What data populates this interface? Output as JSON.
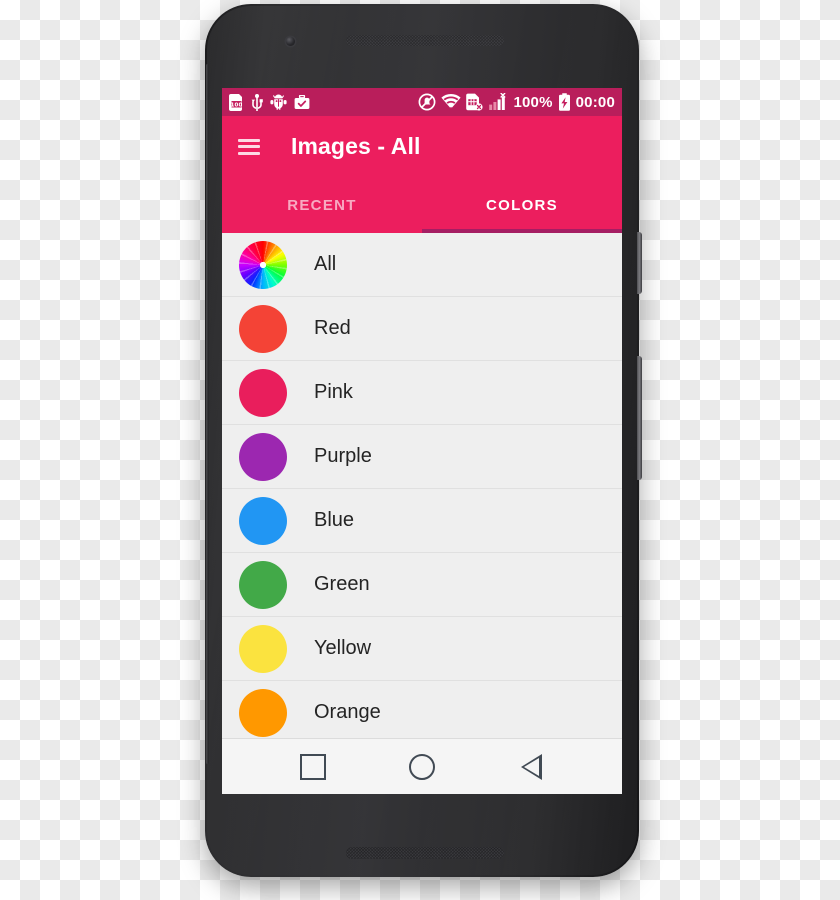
{
  "device": {
    "frame_color": "#2c2c2e",
    "camera": "front-camera",
    "earpiece": "earpiece-speaker",
    "bottom_speaker": "bottom-speaker",
    "buttons": [
      "power-button",
      "volume-rocker"
    ]
  },
  "status_bar": {
    "background": "#b91e5b",
    "left_icons": [
      {
        "name": "sim-100-icon",
        "label": "100"
      },
      {
        "name": "usb-icon",
        "label": ""
      },
      {
        "name": "android-debug-bug-icon",
        "label": ""
      },
      {
        "name": "work-profile-briefcase-icon",
        "label": ""
      }
    ],
    "right_icons": [
      {
        "name": "do-not-disturb-icon",
        "label": ""
      },
      {
        "name": "wifi-icon",
        "label": ""
      },
      {
        "name": "sim-card-error-icon",
        "label": ""
      },
      {
        "name": "signal-bars-no-service-icon",
        "label": ""
      }
    ],
    "battery_percent": "100%",
    "battery_icon": "battery-charging-icon",
    "clock": "00:00"
  },
  "toolbar": {
    "background": "#ec1e5e",
    "menu_icon": "hamburger-menu-icon",
    "title": "Images - All"
  },
  "tabs": {
    "indicator_color": "#a51e63",
    "active_index": 1,
    "items": [
      {
        "label": "RECENT",
        "active": false
      },
      {
        "label": "COLORS",
        "active": true
      }
    ]
  },
  "list": {
    "background": "#efefef",
    "rows": [
      {
        "label": "All",
        "color": "rainbow",
        "swatch": "rainbow-pinwheel-swatch"
      },
      {
        "label": "Red",
        "color": "#F44336",
        "swatch": "color-swatch"
      },
      {
        "label": "Pink",
        "color": "#E91E5C",
        "swatch": "color-swatch"
      },
      {
        "label": "Purple",
        "color": "#9C27B0",
        "swatch": "color-swatch"
      },
      {
        "label": "Blue",
        "color": "#2196F3",
        "swatch": "color-swatch"
      },
      {
        "label": "Green",
        "color": "#42A948",
        "swatch": "color-swatch"
      },
      {
        "label": "Yellow",
        "color": "#FBE33F",
        "swatch": "color-swatch"
      },
      {
        "label": "Orange",
        "color": "#FF9800",
        "swatch": "color-swatch"
      }
    ]
  },
  "navbar": {
    "background": "#f5f5f5",
    "buttons": [
      {
        "name": "recents-button",
        "icon": "square-icon"
      },
      {
        "name": "home-button",
        "icon": "circle-icon"
      },
      {
        "name": "back-button",
        "icon": "triangle-left-icon"
      }
    ]
  }
}
